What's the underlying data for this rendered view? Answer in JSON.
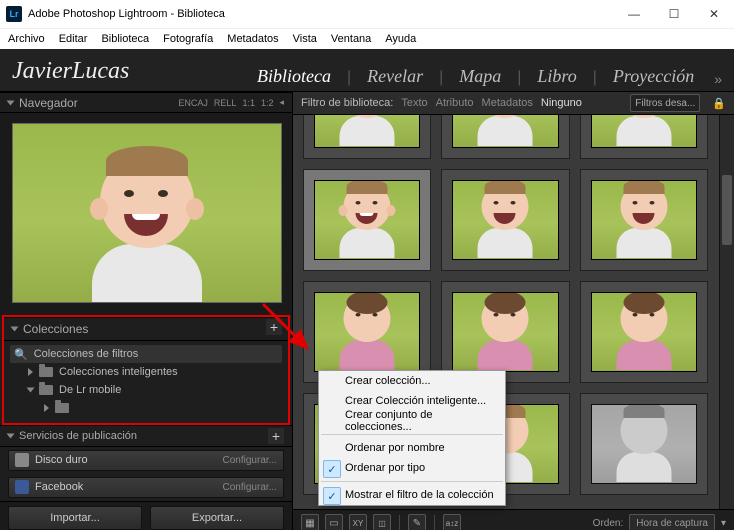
{
  "window": {
    "title": "Adobe Photoshop Lightroom - Biblioteca",
    "logo": "Lr"
  },
  "menu": [
    "Archivo",
    "Editar",
    "Biblioteca",
    "Fotografía",
    "Metadatos",
    "Vista",
    "Ventana",
    "Ayuda"
  ],
  "identity": "JavierLucas",
  "modules": {
    "items": [
      "Biblioteca",
      "Revelar",
      "Mapa",
      "Libro",
      "Proyección"
    ],
    "arrow": "»"
  },
  "navigator": {
    "title": "Navegador",
    "opts": [
      "ENCAJ",
      "RELL",
      "1:1",
      "1:2"
    ],
    "tri": "◂"
  },
  "collections": {
    "title": "Colecciones",
    "plus": "+",
    "root": "Colecciones de filtros",
    "items": [
      "Colecciones inteligentes",
      "De Lr mobile"
    ]
  },
  "publish": {
    "title": "Servicios de publicación",
    "services": [
      {
        "name": "Disco duro",
        "cfg": "Configurar..."
      },
      {
        "name": "Facebook",
        "cfg": "Configurar..."
      }
    ]
  },
  "impexp": {
    "import": "Importar...",
    "export": "Exportar..."
  },
  "filterbar": {
    "label": "Filtro de biblioteca:",
    "tabs": [
      "Texto",
      "Atributo",
      "Metadatos",
      "Ninguno"
    ],
    "preset": "Filtros desa..."
  },
  "toolbar": {
    "sort_label": "Orden:",
    "sort_value": "Hora de captura"
  },
  "context_menu": {
    "items": [
      "Crear colección...",
      "Crear Colección inteligente...",
      "Crear conjunto de colecciones..."
    ],
    "items2": [
      "Ordenar por nombre",
      "Ordenar por tipo"
    ],
    "items3": [
      "Mostrar el filtro de la colección"
    ]
  }
}
